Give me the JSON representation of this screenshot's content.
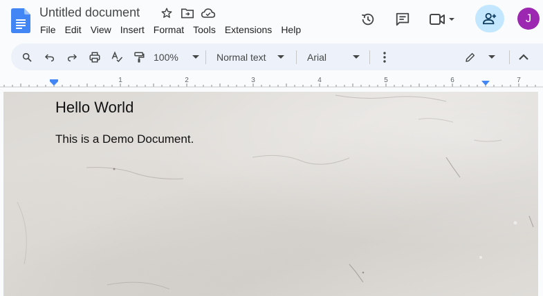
{
  "document": {
    "title": "Untitled document",
    "heading": "Hello World",
    "body_text": "This is a Demo Document."
  },
  "menu": [
    "File",
    "Edit",
    "View",
    "Insert",
    "Format",
    "Tools",
    "Extensions",
    "Help"
  ],
  "toolbar": {
    "zoom": "100%",
    "style": "Normal text",
    "font": "Arial"
  },
  "ruler": [
    "1",
    "2",
    "3",
    "4",
    "5",
    "6",
    "7"
  ],
  "user": {
    "initial": "J",
    "avatar_color": "#9c27b0"
  },
  "colors": {
    "docs_blue": "#4285f4",
    "share_bg": "#c2e7ff",
    "toolbar_bg": "#edf2fa"
  },
  "icons": {
    "title_row": [
      "star-icon",
      "move-to-folder-icon",
      "cloud-saved-icon"
    ],
    "header_right": [
      "version-history-icon",
      "comments-icon",
      "meet-camera-icon",
      "share-add-person-icon"
    ],
    "toolbar": [
      "search-menus-icon",
      "undo-icon",
      "redo-icon",
      "print-icon",
      "spellcheck-icon",
      "paint-format-icon",
      "more-options-icon",
      "editing-mode-pencil-icon",
      "collapse-toolbar-icon"
    ]
  }
}
